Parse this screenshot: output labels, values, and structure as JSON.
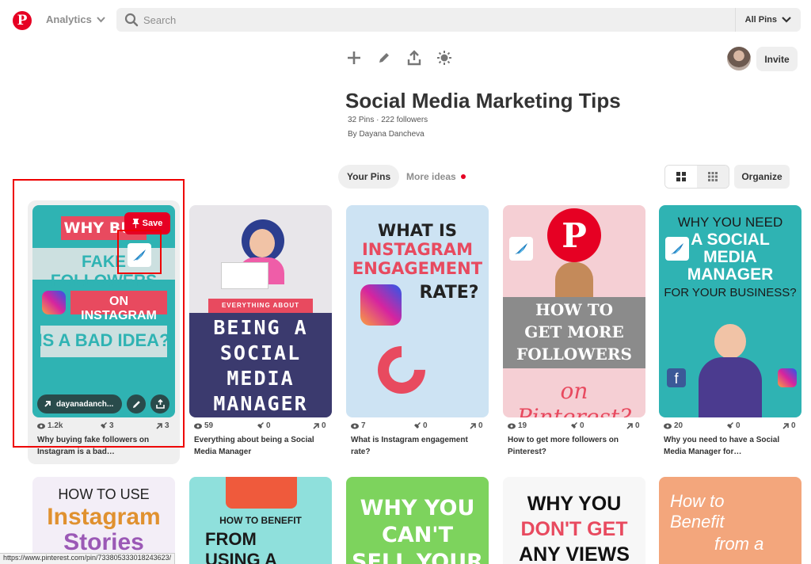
{
  "topbar": {
    "logo": "P",
    "analytics_label": "Analytics",
    "search_placeholder": "Search",
    "scope_label": "All Pins"
  },
  "board": {
    "title": "Social Media Marketing Tips",
    "meta": "32 Pins · 222 followers",
    "by": "By Dayana Dancheva",
    "invite_label": "Invite",
    "tools": [
      "plus-icon",
      "pencil-icon",
      "share-icon",
      "sparkle-icon"
    ]
  },
  "tabs": {
    "yours": "Your Pins",
    "more": "More ideas",
    "organize": "Organize"
  },
  "pins": [
    {
      "save_label": "Save",
      "link_label": "dayanadanch...",
      "views": "1.2k",
      "saves": "3",
      "clicks": "3",
      "description": "Why buying fake followers on Instagram is a bad…",
      "art": [
        "WHY BUY",
        "FAKE FOLLOWERS",
        "ON INSTAGRAM",
        "IS A BAD IDEA?"
      ]
    },
    {
      "views": "59",
      "saves": "0",
      "clicks": "0",
      "description": "Everything about being a Social Media Manager",
      "art": [
        "EVERYTHING ABOUT",
        "BEING A",
        "SOCIAL",
        "MEDIA",
        "MANAGER"
      ]
    },
    {
      "views": "7",
      "saves": "0",
      "clicks": "0",
      "description": "What is Instagram engagement rate?",
      "art": [
        "WHAT IS",
        "INSTAGRAM",
        "ENGAGEMENT",
        "RATE?"
      ]
    },
    {
      "views": "19",
      "saves": "0",
      "clicks": "0",
      "description": "How to get more followers on Pinterest?",
      "art": [
        "HOW TO",
        "GET MORE",
        "FOLLOWERS",
        "on Pinterest?"
      ]
    },
    {
      "views": "20",
      "saves": "0",
      "clicks": "0",
      "description": "Why you need to have a Social Media Manager for…",
      "art": [
        "WHY YOU NEED",
        "A SOCIAL",
        "MEDIA",
        "MANAGER",
        "FOR YOUR BUSINESS?"
      ]
    }
  ],
  "row2": [
    {
      "art": [
        "HOW TO USE",
        "Instagram",
        "Stories"
      ]
    },
    {
      "art": [
        "HOW TO BENEFIT",
        "FROM",
        "USING A"
      ]
    },
    {
      "art": [
        "WHY YOU",
        "CAN'T",
        "SELL YOUR"
      ]
    },
    {
      "art": [
        "WHY YOU",
        "DON'T GET",
        "ANY VIEWS"
      ]
    },
    {
      "art": [
        "How to",
        "Benefit",
        "from a"
      ]
    }
  ],
  "status_url": "https://www.pinterest.com/pin/733805333018243623/",
  "colors": {
    "brand": "#e60023",
    "teal": "#2fb3b3",
    "navy": "#3b3a6e"
  }
}
